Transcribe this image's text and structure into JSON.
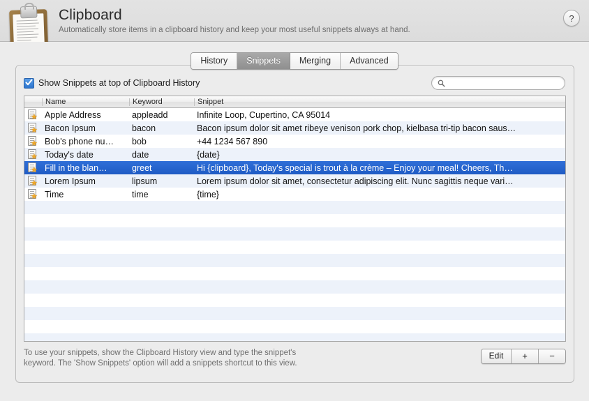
{
  "header": {
    "title": "Clipboard",
    "subtitle": "Automatically store items in a clipboard history and keep your most useful snippets always at hand.",
    "icon": "clipboard-icon",
    "help_label": "?"
  },
  "tabs": [
    {
      "label": "History",
      "selected": false
    },
    {
      "label": "Snippets",
      "selected": true
    },
    {
      "label": "Merging",
      "selected": false
    },
    {
      "label": "Advanced",
      "selected": false
    }
  ],
  "options": {
    "show_snippets_label": "Show Snippets at top of Clipboard History",
    "show_snippets_checked": true
  },
  "search": {
    "value": "",
    "placeholder": "",
    "icon": "search-icon"
  },
  "table": {
    "columns": [
      "Name",
      "Keyword",
      "Snippet"
    ],
    "rows": [
      {
        "name": "Apple Address",
        "keyword": "appleadd",
        "snippet": "Infinite Loop, Cupertino, CA 95014",
        "selected": false
      },
      {
        "name": "Bacon Ipsum",
        "keyword": "bacon",
        "snippet": "Bacon ipsum dolor sit amet ribeye venison pork chop, kielbasa tri-tip bacon saus…",
        "selected": false
      },
      {
        "name": "Bob's phone nu…",
        "keyword": "bob",
        "snippet": "+44 1234 567 890",
        "selected": false
      },
      {
        "name": "Today's date",
        "keyword": "date",
        "snippet": "{date}",
        "selected": false
      },
      {
        "name": "Fill in the blan…",
        "keyword": "greet",
        "snippet": "Hi {clipboard},  Today's special is trout à la crème – Enjoy your meal!  Cheers, Th…",
        "selected": true
      },
      {
        "name": "Lorem Ipsum",
        "keyword": "lipsum",
        "snippet": "Lorem ipsum dolor sit amet, consectetur adipiscing elit. Nunc sagittis neque vari…",
        "selected": false
      },
      {
        "name": "Time",
        "keyword": "time",
        "snippet": "{time}",
        "selected": false
      }
    ],
    "empty_row_count": 11
  },
  "footer": {
    "note_line1": "To use your snippets, show the Clipboard History view and type the snippet's",
    "note_line2": "keyword. The 'Show Snippets' option will add a snippets shortcut to this view.",
    "edit_label": "Edit",
    "add_label": "+",
    "remove_label": "−"
  },
  "colors": {
    "selection_blue": "#2462cc",
    "alt_row": "#edf2fa",
    "checkbox_blue": "#2c74cd",
    "window_bg": "#ececec"
  }
}
